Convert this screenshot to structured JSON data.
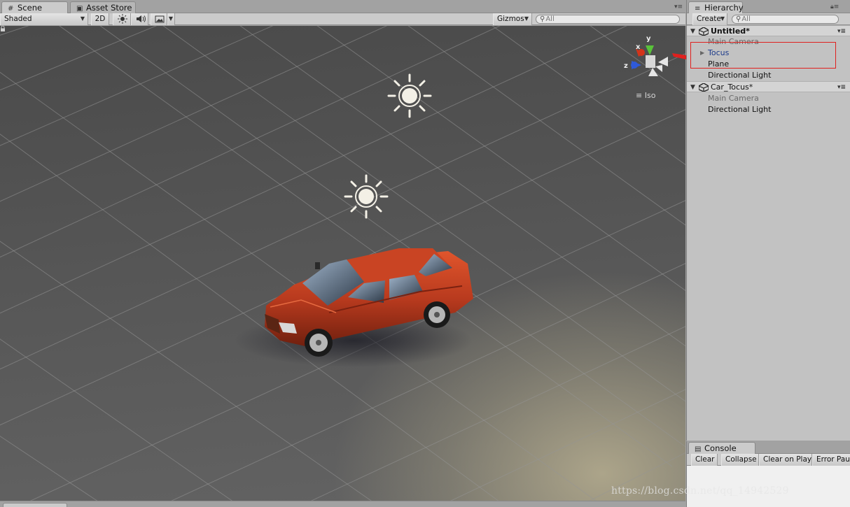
{
  "scene_window": {
    "tabs": [
      {
        "label": "Scene",
        "icon": "hash-icon",
        "active": true
      },
      {
        "label": "Asset Store",
        "icon": "store-bag-icon",
        "active": false
      }
    ],
    "toolbar": {
      "draw_mode": "Shaded",
      "mode_2d": "2D",
      "gizmos": "Gizmos",
      "search_placeholder": "All"
    },
    "gizmo": {
      "x_label": "x",
      "y_label": "y",
      "z_label": "z",
      "projection_label": "Iso"
    }
  },
  "hierarchy": {
    "tab_label": "Hierarchy",
    "create_label": "Create",
    "search_placeholder": "All",
    "scenes": [
      {
        "name": "Untitled*",
        "items": [
          {
            "label": "Main Camera",
            "state": "inactive"
          },
          {
            "label": "Tocus",
            "state": "prefab",
            "expandable": true
          },
          {
            "label": "Plane",
            "state": "normal"
          },
          {
            "label": "Directional Light",
            "state": "normal"
          }
        ]
      },
      {
        "name": "Car_Tocus*",
        "items": [
          {
            "label": "Main Camera",
            "state": "inactive"
          },
          {
            "label": "Directional Light",
            "state": "normal"
          }
        ]
      }
    ]
  },
  "console": {
    "tab_label": "Console",
    "buttons": [
      "Clear",
      "Collapse",
      "Clear on Play",
      "Error Paus"
    ]
  },
  "watermark": "https://blog.csdn.net/qq_14942529",
  "colors": {
    "annotation_red": "#e0201e",
    "car_body": "#b83a1e",
    "prefab_text": "#1c3a8a"
  }
}
